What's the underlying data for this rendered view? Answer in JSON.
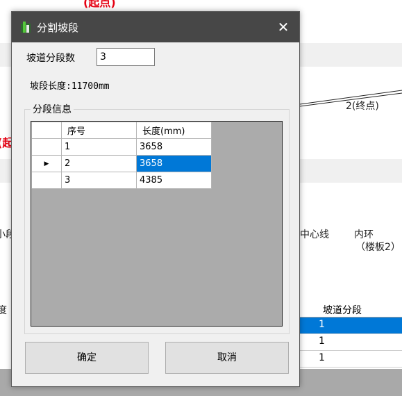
{
  "background": {
    "top_red_text": "(起点)",
    "side_red_text": "(起",
    "end_point_label": "2(终点)",
    "left_fragment": "小段",
    "center_line_label": "中心线",
    "inner_ring_label": "内环",
    "floor_label": "（楼板2）",
    "table_left_fragment": "度",
    "table": {
      "header": "坡道分段",
      "rows": [
        "1",
        "1",
        "1"
      ]
    }
  },
  "dialog": {
    "title": "分割坡段",
    "app_icon": "ramp-app-icon",
    "close_symbol": "✕",
    "segment_count_label": "坡道分段数",
    "segment_count_value": "3",
    "segment_length": "坡段长度:11700mm",
    "group_title": "分段信息",
    "grid": {
      "columns": [
        "序号",
        "长度(mm)"
      ],
      "current_row_marker": "▶",
      "rows": [
        {
          "index": "1",
          "length": "3658"
        },
        {
          "index": "2",
          "length": "3658"
        },
        {
          "index": "3",
          "length": "4385"
        }
      ]
    },
    "ok_label": "确定",
    "cancel_label": "取消"
  },
  "colors": {
    "title_bar": "#474747",
    "selection": "#0078d7",
    "annotation_red": "#e60012"
  }
}
